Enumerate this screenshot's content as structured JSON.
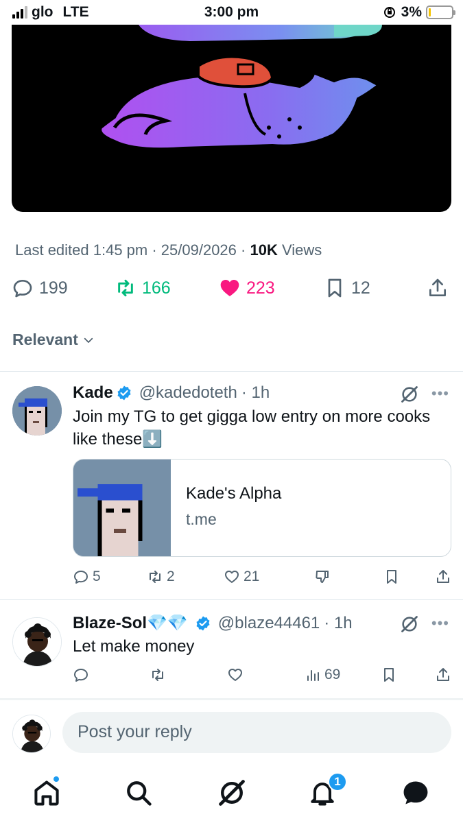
{
  "status_bar": {
    "carrier": "glo",
    "network": "LTE",
    "time": "3:00 pm",
    "battery": "3%"
  },
  "post": {
    "last_edited": "Last edited 1:45 pm · 25/09/2026",
    "views_count": "10K",
    "views_label": "Views",
    "replies": "199",
    "reposts": "166",
    "likes": "223",
    "bookmarks": "12"
  },
  "sort": {
    "label": "Relevant"
  },
  "replies": [
    {
      "name": "Kade",
      "handle": "@kadedoteth",
      "time": "· 1h",
      "text": "Join my TG to get gigga low entry on more cooks like these⬇️",
      "card": {
        "title": "Kade's Alpha",
        "domain": "t.me"
      },
      "replies": "5",
      "reposts": "2",
      "likes": "21"
    },
    {
      "name": "Blaze-Sol💎💎",
      "handle": "@blaze44461",
      "time": "· 1h",
      "text": "Let make money",
      "views": "69"
    }
  ],
  "reply_bar": {
    "placeholder": "Post your reply"
  },
  "nav": {
    "notifications_badge": "1"
  },
  "colors": {
    "accent": "#1d9bf0",
    "repost": "#00ba7c",
    "like": "#f91880",
    "muted": "#536471"
  }
}
